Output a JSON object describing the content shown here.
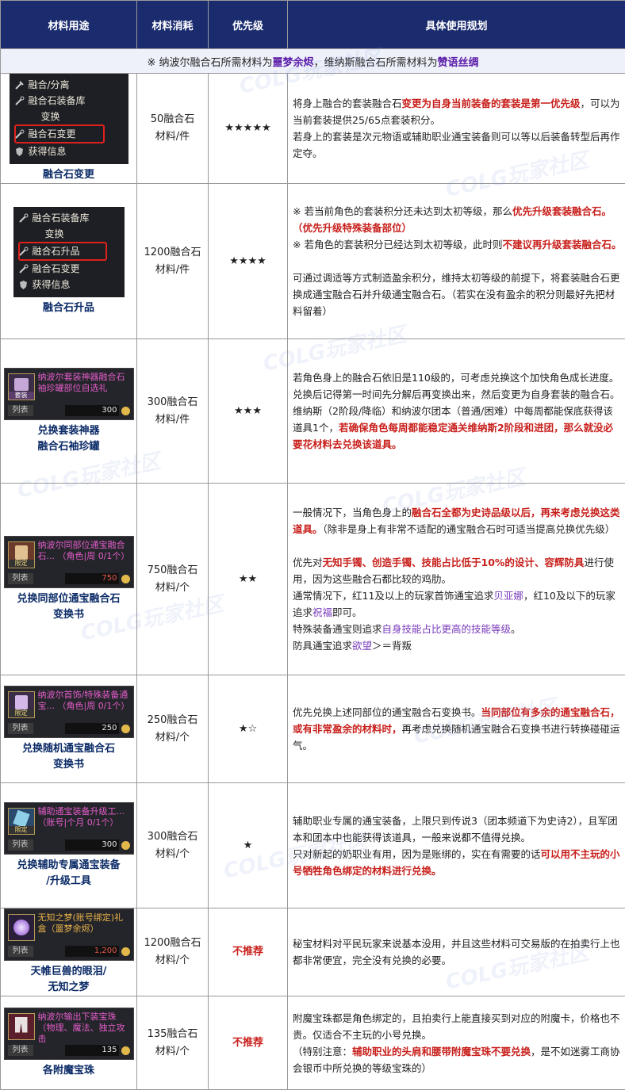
{
  "header": {
    "col1": "材料用途",
    "col2": "材料消耗",
    "col3": "优先级",
    "col4": "具体使用规划"
  },
  "notice": {
    "p1": "※ 纳波尔融合石所需材料为",
    "h1": "噩梦余烬",
    "p2": "，维纳斯融合石所需材料为",
    "h2": "赞语丝绸"
  },
  "watermark": "COLG玩家社区",
  "rows": [
    {
      "menu": [
        "融合/分离",
        "融合石装备库",
        "变换",
        "融合石变更",
        "获得信息"
      ],
      "name": [
        "融合石变更"
      ],
      "cost": [
        "50融合石",
        "材料/件"
      ],
      "priority": "★★★★★",
      "plan": {
        "p1a": "将身上融合的套装融合石",
        "p1b": "变更为自身当前装备的套装是第一优先级",
        "p1c": "，可以为当前套装提供25/65点套装积分。",
        "p2": "若身上的套装是次元物语或辅助职业通宝装备则可以等以后装备转型后再作定夺。"
      }
    },
    {
      "menu": [
        "融合石装备库",
        "变换",
        "融合石升品",
        "融合石变更",
        "获得信息"
      ],
      "name": [
        "融合石升品"
      ],
      "cost": [
        "1200融合石",
        "材料/件"
      ],
      "priority": "★★★★",
      "plan": {
        "p1a": "※ 若当前角色的套装积分还未达到太初等级，那么",
        "p1b": "优先升级套装融合石。（优先升级特殊装备部位）",
        "p2a": "※ 若角色的套装积分已经达到太初等级，此时则",
        "p2b": "不建议再升级套装融合石。",
        "p3": "可通过调适等方式制造盈余积分，维持太初等级的前提下，将套装融合石更换成通宝融合石并升级通宝融合石。（若实在没有盈余的积分则最好先把材料留着）"
      }
    },
    {
      "card": {
        "title": "纳波尔套装神器融合石袖珍罐部位自选礼",
        "tag": "",
        "list": "列表",
        "price": "300"
      },
      "name": [
        "兑换套装神器",
        "融合石袖珍罐"
      ],
      "cost": [
        "300融合石",
        "材料/件"
      ],
      "priority": "★★★",
      "plan": {
        "p1": "若角色身上的融合石依旧是110级的，可考虑兑换这个加快角色成长进度。兑换后记得第一时间先分解后再变换出来，然后变更为自身套装的融合石。",
        "p2a": "维纳斯（2阶段/降临）和纳波尔团本（普通/困难）中每周都能保底获得该道具1个，",
        "p2b": "若确保角色每周都能稳定通关维纳斯2阶段和进团，那么就没必要花材料去兑换该道具。"
      }
    },
    {
      "card": {
        "title": "纳波尔同部位通宝融合石... （角色|周 0/1个）",
        "tag": "限定",
        "list": "列表",
        "price": "750"
      },
      "name": [
        "兑换同部位通宝融合石",
        "变换书"
      ],
      "cost": [
        "750融合石",
        "材料/个"
      ],
      "priority": "★★",
      "plan": {
        "p1a": "一般情况下，当角色身上的",
        "p1b": "融合石全都为史诗品级以后，再来考虑兑换这类道具。",
        "p1c": "（除非是身上有非常不适配的通宝融合石时可适当提高兑换优先级）",
        "p2a": "优先对",
        "p2b": "无知手镯、创造手镯、技能占比低于10%的设计、容辉防具",
        "p2c": "进行使用，因为这些融合石都比较的鸡肋。",
        "p3a": "通常情况下，红11及以上的玩家首饰通宝追求",
        "p3b": "贝亚娜",
        "p3c": "，红10及以下的玩家追求",
        "p3d": "祝福",
        "p3e": "即可。",
        "p4a": "特殊装备通宝则追求",
        "p4b": "自身技能占比更高的技能等级",
        "p4c": "。",
        "p5a": "防具通宝追求",
        "p5b": "欲望",
        "p5c": "＞＝背叛"
      }
    },
    {
      "card": {
        "title": "纳波尔首饰/特殊装备通宝... （角色|周 0/1个）",
        "tag": "限定",
        "list": "列表",
        "price": "250"
      },
      "name": [
        "兑换随机通宝融合石",
        "变换书"
      ],
      "cost": [
        "250融合石",
        "材料/个"
      ],
      "priority": "★☆",
      "plan": {
        "p1a": "优先兑换上述同部位的通宝融合石变换书。",
        "p1b": "当同部位有多余的通宝融合石，或有非常盈余的材料时，",
        "p1c": "再考虑兑换随机通宝融合石变换书进行转换碰碰运气。"
      }
    },
    {
      "card": {
        "title": "辅助通宝装备升级工... （账号|个月 0/1个）",
        "tag": "限定",
        "list": "列表",
        "price": "300"
      },
      "name": [
        "兑换辅助专属通宝装备",
        "/升级工具"
      ],
      "cost": [
        "300融合石",
        "材料/个"
      ],
      "priority": "★",
      "plan": {
        "p1": "辅助职业专属的通宝装备，上限只到传说3（团本频道下为史诗2），且军团本和团本中也能获得该道具，一般来说都不值得兑换。",
        "p2a": "只对新起的奶职业有用，因为是账绑的，实在有需要的话",
        "p2b": "可以用不主玩的小号牺牲角色绑定的材料进行兑换。"
      }
    },
    {
      "card": {
        "title": "无知之梦(账号绑定)礼盒（噩梦余烬）",
        "tag": "",
        "list": "列表",
        "price": "1,200"
      },
      "name": [
        "天帷巨兽的眼泪/",
        "无知之梦"
      ],
      "cost": [
        "1200融合石",
        "材料/个"
      ],
      "priority": "不推荐",
      "plan": {
        "p1": "秘宝材料对平民玩家来说基本没用，并且这些材料可交易版的在拍卖行上也都非常便宜，完全没有兑换的必要。"
      }
    },
    {
      "card": {
        "title": "纳波尔输出下装宝珠（物理、魔法、独立攻击",
        "tag": "",
        "list": "列表",
        "price": "135"
      },
      "name": [
        "各附魔宝珠"
      ],
      "cost": [
        "135融合石",
        "材料/个"
      ],
      "priority": "不推荐",
      "plan": {
        "p1": "附魔宝珠都是角色绑定的，且拍卖行上能直接买到对应的附魔卡，价格也不贵。仅适合不主玩的小号兑换。",
        "p2a": "（特别注意：",
        "p2b": "辅助职业的头肩和腰带附魔宝珠不要兑换",
        "p2c": "，是不如迷雾工商协会银币中所兑换的等级宝珠的）"
      }
    }
  ]
}
